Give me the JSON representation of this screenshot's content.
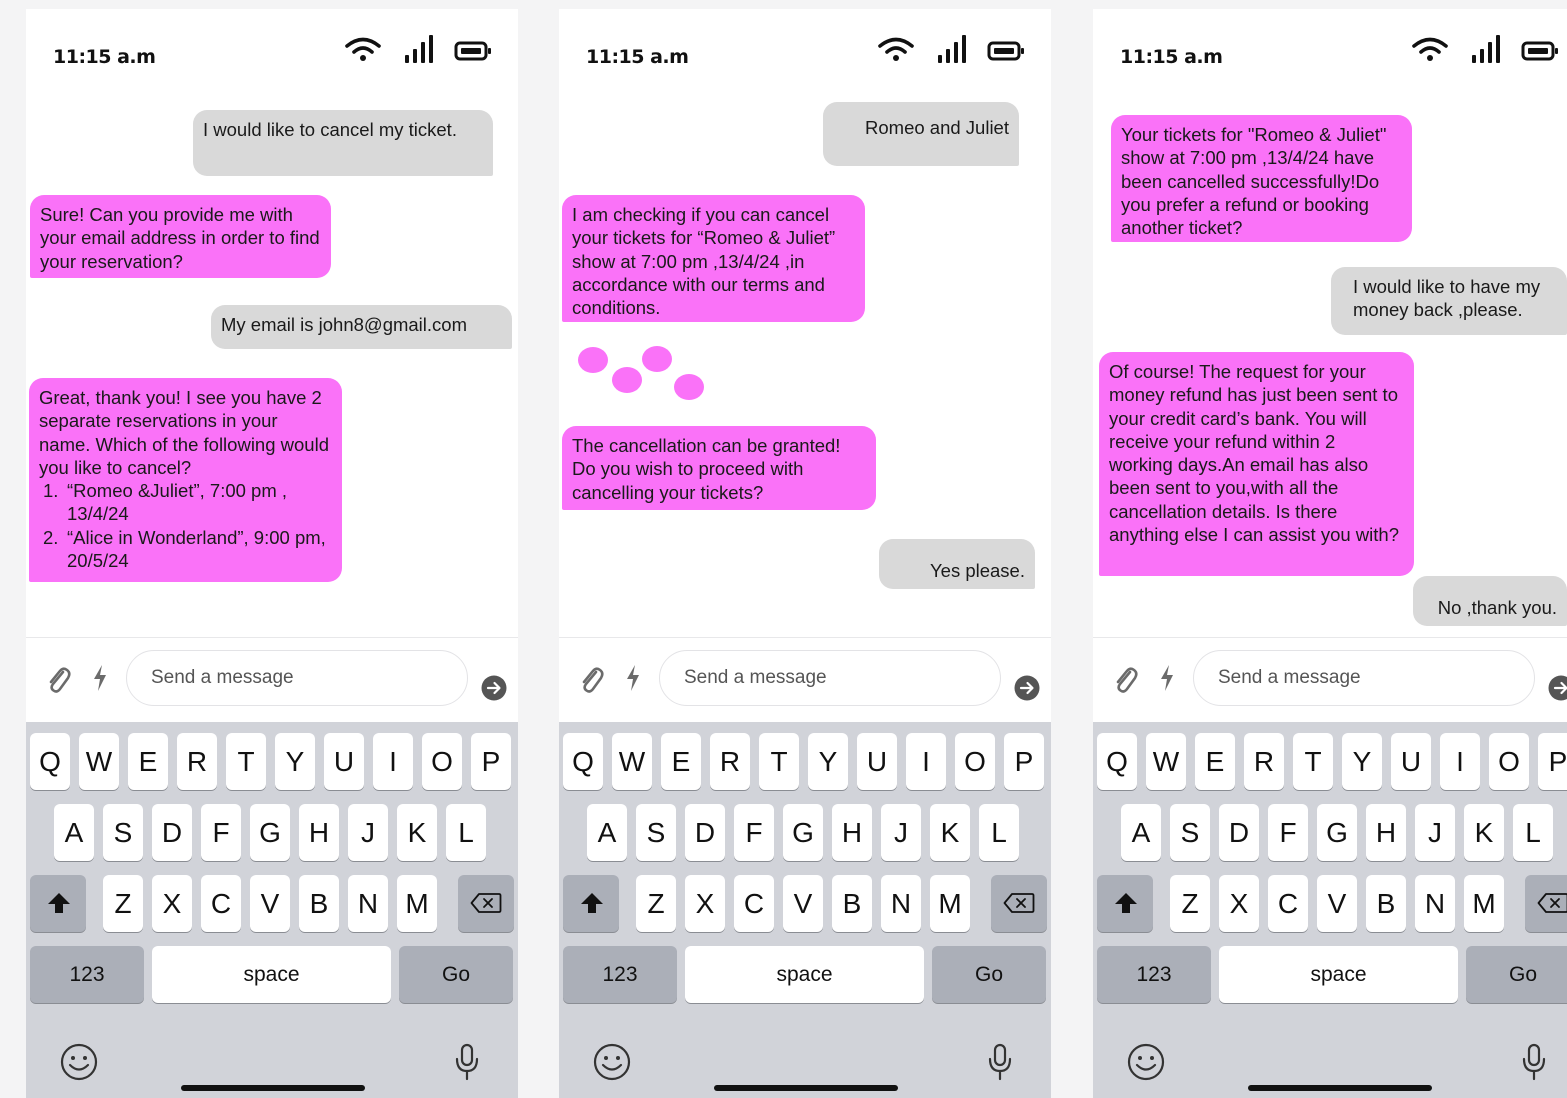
{
  "common": {
    "time": "11:15 a.m",
    "input_placeholder": "Send a message",
    "keyboard": {
      "row1": [
        "Q",
        "W",
        "E",
        "R",
        "T",
        "Y",
        "U",
        "I",
        "O",
        "P"
      ],
      "row2": [
        "A",
        "S",
        "D",
        "F",
        "G",
        "H",
        "J",
        "K",
        "L"
      ],
      "row3": [
        "Z",
        "X",
        "C",
        "V",
        "B",
        "N",
        "M"
      ],
      "numbers_label": "123",
      "space_label": "space",
      "go_label": "Go"
    },
    "icons": [
      "wifi-icon",
      "signal-icon",
      "battery-icon",
      "paperclip-icon",
      "lightning-icon",
      "send-icon",
      "shift-icon",
      "backspace-icon",
      "emoji-icon",
      "microphone-icon"
    ]
  },
  "colors": {
    "bot_bubble": "#fa72f8",
    "user_bubble": "#d9d9d9",
    "keyboard_bg": "#d1d3d9",
    "dark_key": "#abafb8"
  },
  "screens": [
    {
      "messages": [
        {
          "sender": "user",
          "text": "I would like to cancel my ticket."
        },
        {
          "sender": "bot",
          "text": "Sure! Can you provide me with your email address in order to find your reservation?"
        },
        {
          "sender": "user",
          "text": "My email is john8@gmail.com"
        },
        {
          "sender": "bot",
          "text": "Great, thank you! I see you have 2 separate reservations in your name. Which of the following would you like to cancel?",
          "list": [
            {
              "num": "1.",
              "text": "“Romeo &Juliet”, 7:00 pm , 13/4/24"
            },
            {
              "num": "2.",
              "text": "“Alice in Wonderland”, 9:00 pm, 20/5/24"
            }
          ]
        }
      ]
    },
    {
      "messages": [
        {
          "sender": "user",
          "text": "Romeo and Juliet"
        },
        {
          "sender": "bot",
          "text": "I am checking if you can cancel your tickets for “Romeo & Juliet” show at 7:00 pm ,13/4/24 ,in accordance with our terms and conditions."
        },
        {
          "sender": "bot",
          "text": "The cancellation can be granted! Do you wish to proceed with cancelling your tickets?"
        },
        {
          "sender": "user",
          "text": "Yes please."
        }
      ]
    },
    {
      "messages": [
        {
          "sender": "bot",
          "text": "Your tickets for \"Romeo & Juliet\" show at 7:00 pm ,13/4/24 have been cancelled successfully!Do you prefer a refund or booking another ticket?"
        },
        {
          "sender": "user",
          "text": "I would like to have my money back ,please."
        },
        {
          "sender": "bot",
          "text": "Of course! The request for your money refund has just been sent to your credit card’s bank. You will receive your refund within 2 working days.An email has also been sent to you,with all the cancellation details. Is there anything else I can assist you with?"
        },
        {
          "sender": "user",
          "text": "No ,thank you."
        }
      ]
    }
  ]
}
